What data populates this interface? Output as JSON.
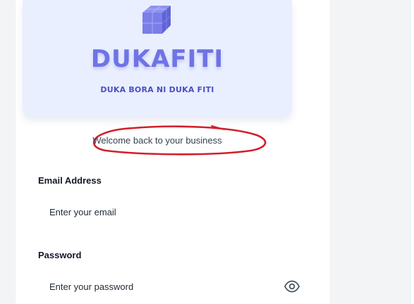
{
  "brand": {
    "name": "DUKAFITI",
    "tagline": "DUKA BORA NI DUKA FITI",
    "logo_icon": "cube-icon",
    "colors": {
      "accent": "#6f73e6",
      "tagline": "#4c4fc0",
      "panel_bg": "#e9efff",
      "highlight": "#d21f2b"
    }
  },
  "welcome_text": "Welcome back to your business",
  "form": {
    "email": {
      "label": "Email Address",
      "placeholder": "Enter your email",
      "value": ""
    },
    "password": {
      "label": "Password",
      "placeholder": "Enter your password",
      "value": "",
      "toggle_icon": "eye-icon"
    }
  }
}
